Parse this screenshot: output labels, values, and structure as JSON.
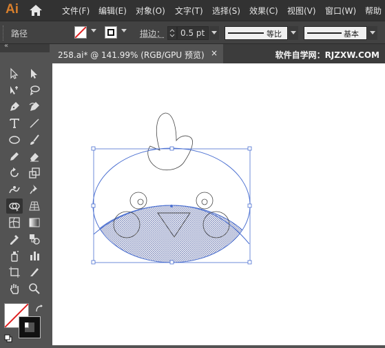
{
  "app": {
    "logo": "Ai"
  },
  "menu": [
    "文件(F)",
    "编辑(E)",
    "对象(O)",
    "文字(T)",
    "选择(S)",
    "效果(C)",
    "视图(V)",
    "窗口(W)",
    "帮助"
  ],
  "control_bar": {
    "object_type": "路径",
    "stroke_label": "描边：",
    "stroke_weight": "0.5 pt",
    "profile_label": "等比",
    "brush_label": "基本"
  },
  "document": {
    "tab_title": "258.ai* @ 141.99% (RGB/GPU 预览)",
    "close": "×"
  },
  "watermark": "软件自学网：RJZXW.COM",
  "colors": {
    "selection": "#4a6fd1",
    "fill_none_slash": "#e02020",
    "accent_logo": "#d87f2c"
  },
  "toolbar": {
    "collapse_glyph": "«",
    "tools": [
      "selection-tool",
      "direct-selection-tool",
      "magic-wand-tool",
      "lasso-tool",
      "pen-tool",
      "curvature-tool",
      "type-tool",
      "line-tool",
      "ellipse-tool",
      "paintbrush-tool",
      "pencil-tool",
      "eraser-tool",
      "rotate-tool",
      "scale-tool",
      "warp-tool",
      "puppet-warp-tool",
      "shape-builder-tool",
      "perspective-grid-tool",
      "mesh-tool",
      "gradient-tool",
      "eyedropper-tool",
      "blend-tool",
      "symbol-sprayer-tool",
      "column-graph-tool",
      "artboard-tool",
      "slice-tool",
      "hand-tool",
      "zoom-tool"
    ]
  }
}
